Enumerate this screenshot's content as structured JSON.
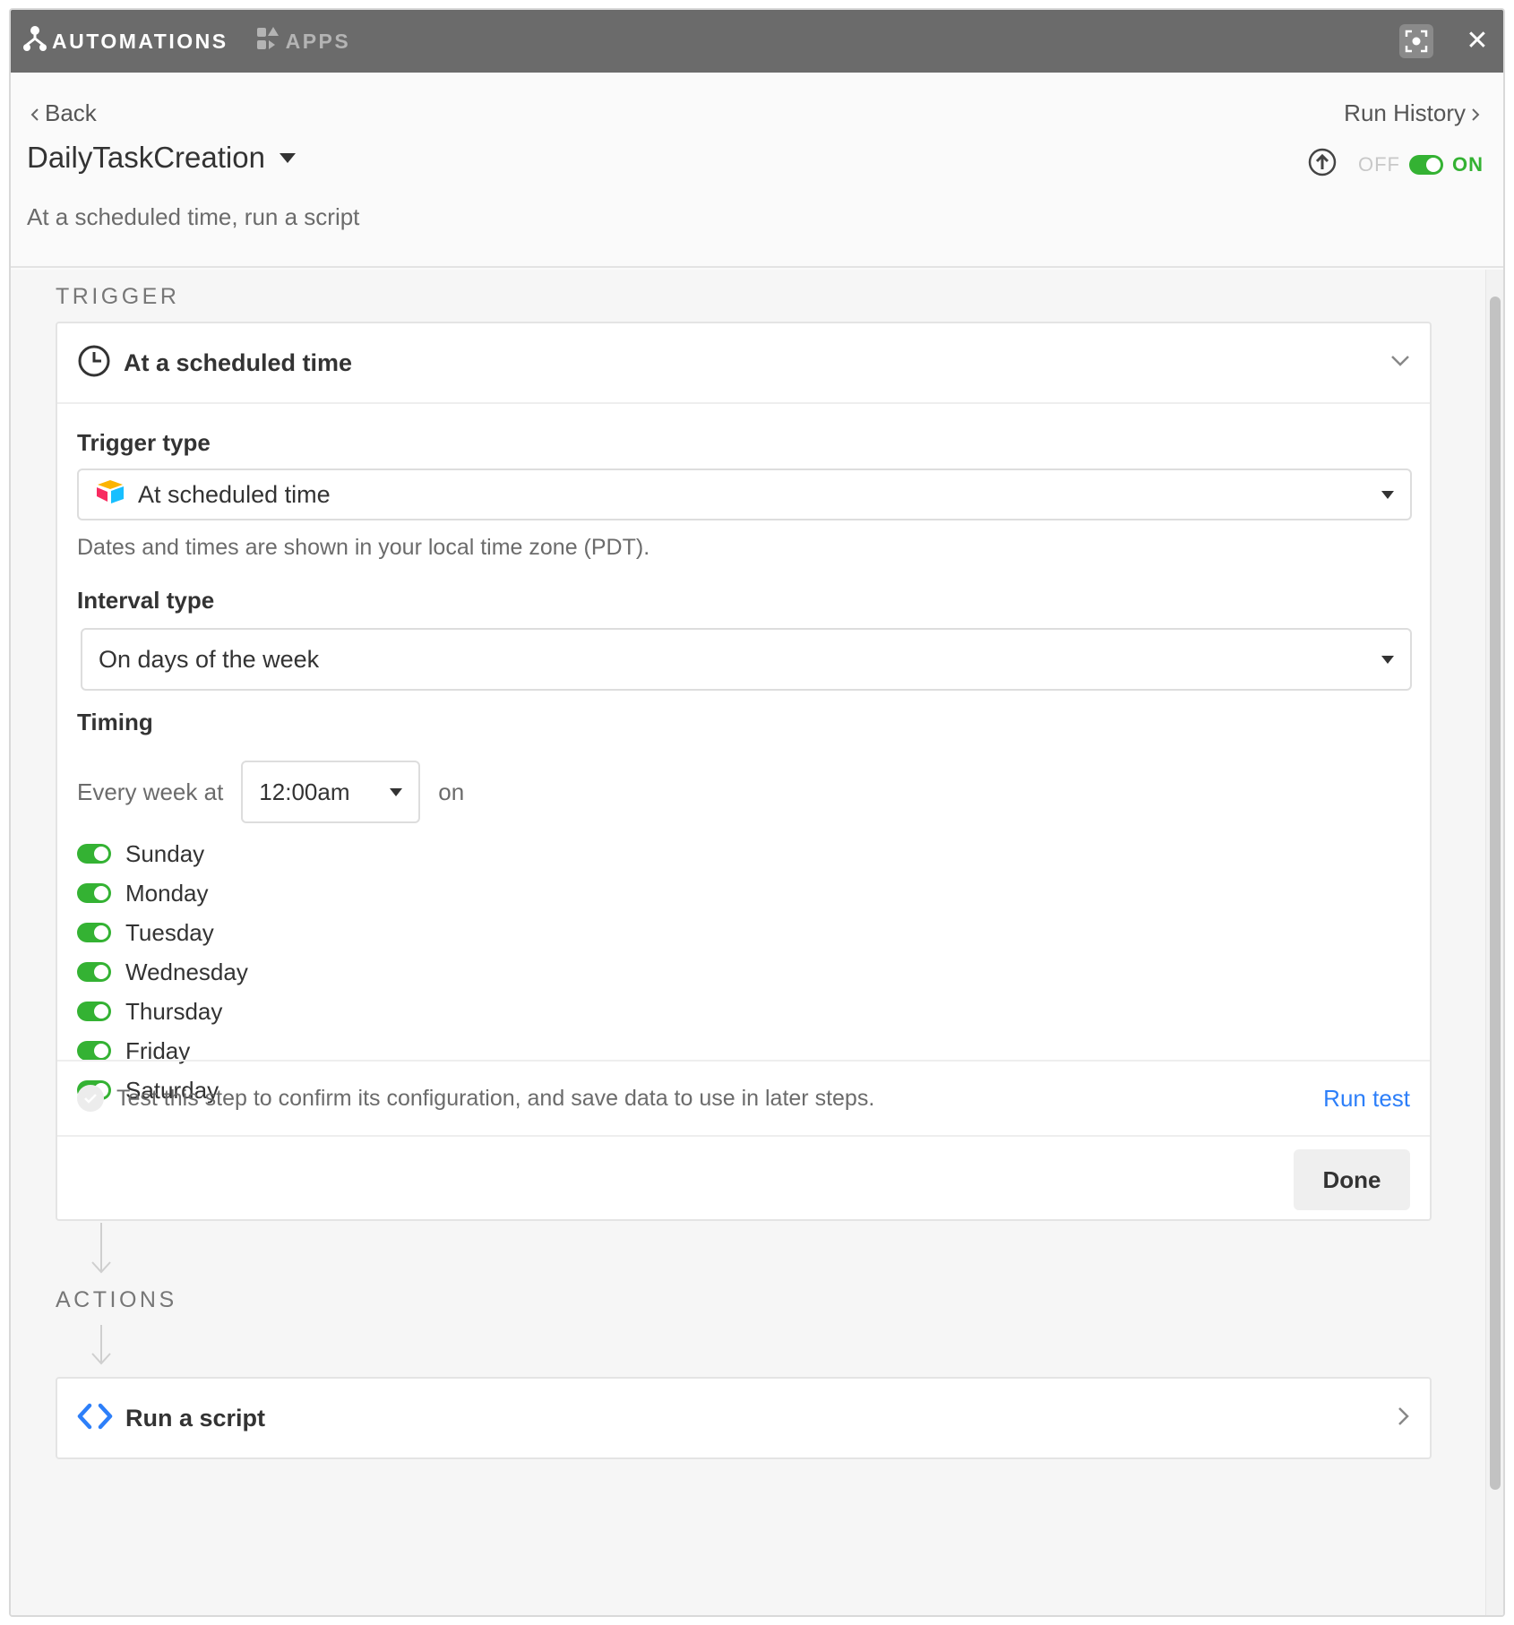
{
  "titlebar": {
    "tabs": [
      {
        "label": "AUTOMATIONS",
        "icon": "automations-icon",
        "active": true
      },
      {
        "label": "APPS",
        "icon": "apps-icon",
        "active": false
      }
    ],
    "expand_icon": "expand-icon",
    "close_icon": "close-icon"
  },
  "header": {
    "back_label": "Back",
    "run_history_label": "Run History",
    "automation_name": "DailyTaskCreation",
    "subtitle": "At a scheduled time, run a script",
    "toggle": {
      "off_label": "OFF",
      "on_label": "ON",
      "state": "on"
    }
  },
  "trigger": {
    "section_label": "TRIGGER",
    "card_title": "At a scheduled time",
    "trigger_type_label": "Trigger type",
    "trigger_type_value": "At scheduled time",
    "timezone_help": "Dates and times are shown in your local time zone (PDT).",
    "interval_type_label": "Interval type",
    "interval_type_value": "On days of the week",
    "timing_label": "Timing",
    "every_week_at": "Every week at",
    "time_value": "12:00am",
    "on_label": "on",
    "days": [
      {
        "label": "Sunday",
        "enabled": true
      },
      {
        "label": "Monday",
        "enabled": true
      },
      {
        "label": "Tuesday",
        "enabled": true
      },
      {
        "label": "Wednesday",
        "enabled": true
      },
      {
        "label": "Thursday",
        "enabled": true
      },
      {
        "label": "Friday",
        "enabled": true
      },
      {
        "label": "Saturday",
        "enabled": true
      }
    ],
    "test_text": "Test this step to confirm its configuration, and save data to use in later steps.",
    "run_test_label": "Run test",
    "done_label": "Done"
  },
  "actions": {
    "section_label": "ACTIONS",
    "items": [
      {
        "label": "Run a script",
        "icon": "code-icon"
      }
    ]
  },
  "colors": {
    "titlebar": "#6b6b6b",
    "toggle_on": "#34b233",
    "link": "#2d7ff9",
    "code_icon": "#2d7ff9"
  }
}
